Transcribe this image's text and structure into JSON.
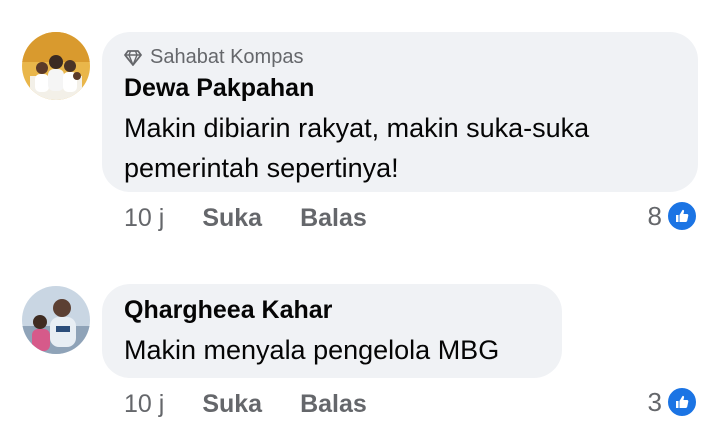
{
  "comments": [
    {
      "badge": "Sahabat Kompas",
      "badge_icon": "diamond-icon",
      "author": "Dewa Pakpahan",
      "text_lines": [
        "Makin dibiarin rakyat, makin suka-suka",
        "pemerintah sepertinya!"
      ],
      "time": "10 j",
      "like_label": "Suka",
      "reply_label": "Balas",
      "reaction_count": "8",
      "reaction_icon": "like-icon"
    },
    {
      "author": "Qhargheea Kahar",
      "text_lines": [
        "Makin menyala pengelola MBG"
      ],
      "time": "10 j",
      "like_label": "Suka",
      "reply_label": "Balas",
      "reaction_count": "3",
      "reaction_icon": "like-icon"
    }
  ],
  "colors": {
    "bubble": "#f0f2f5",
    "text": "#050505",
    "secondary": "#65676b",
    "like_blue": "#1b74e4"
  }
}
